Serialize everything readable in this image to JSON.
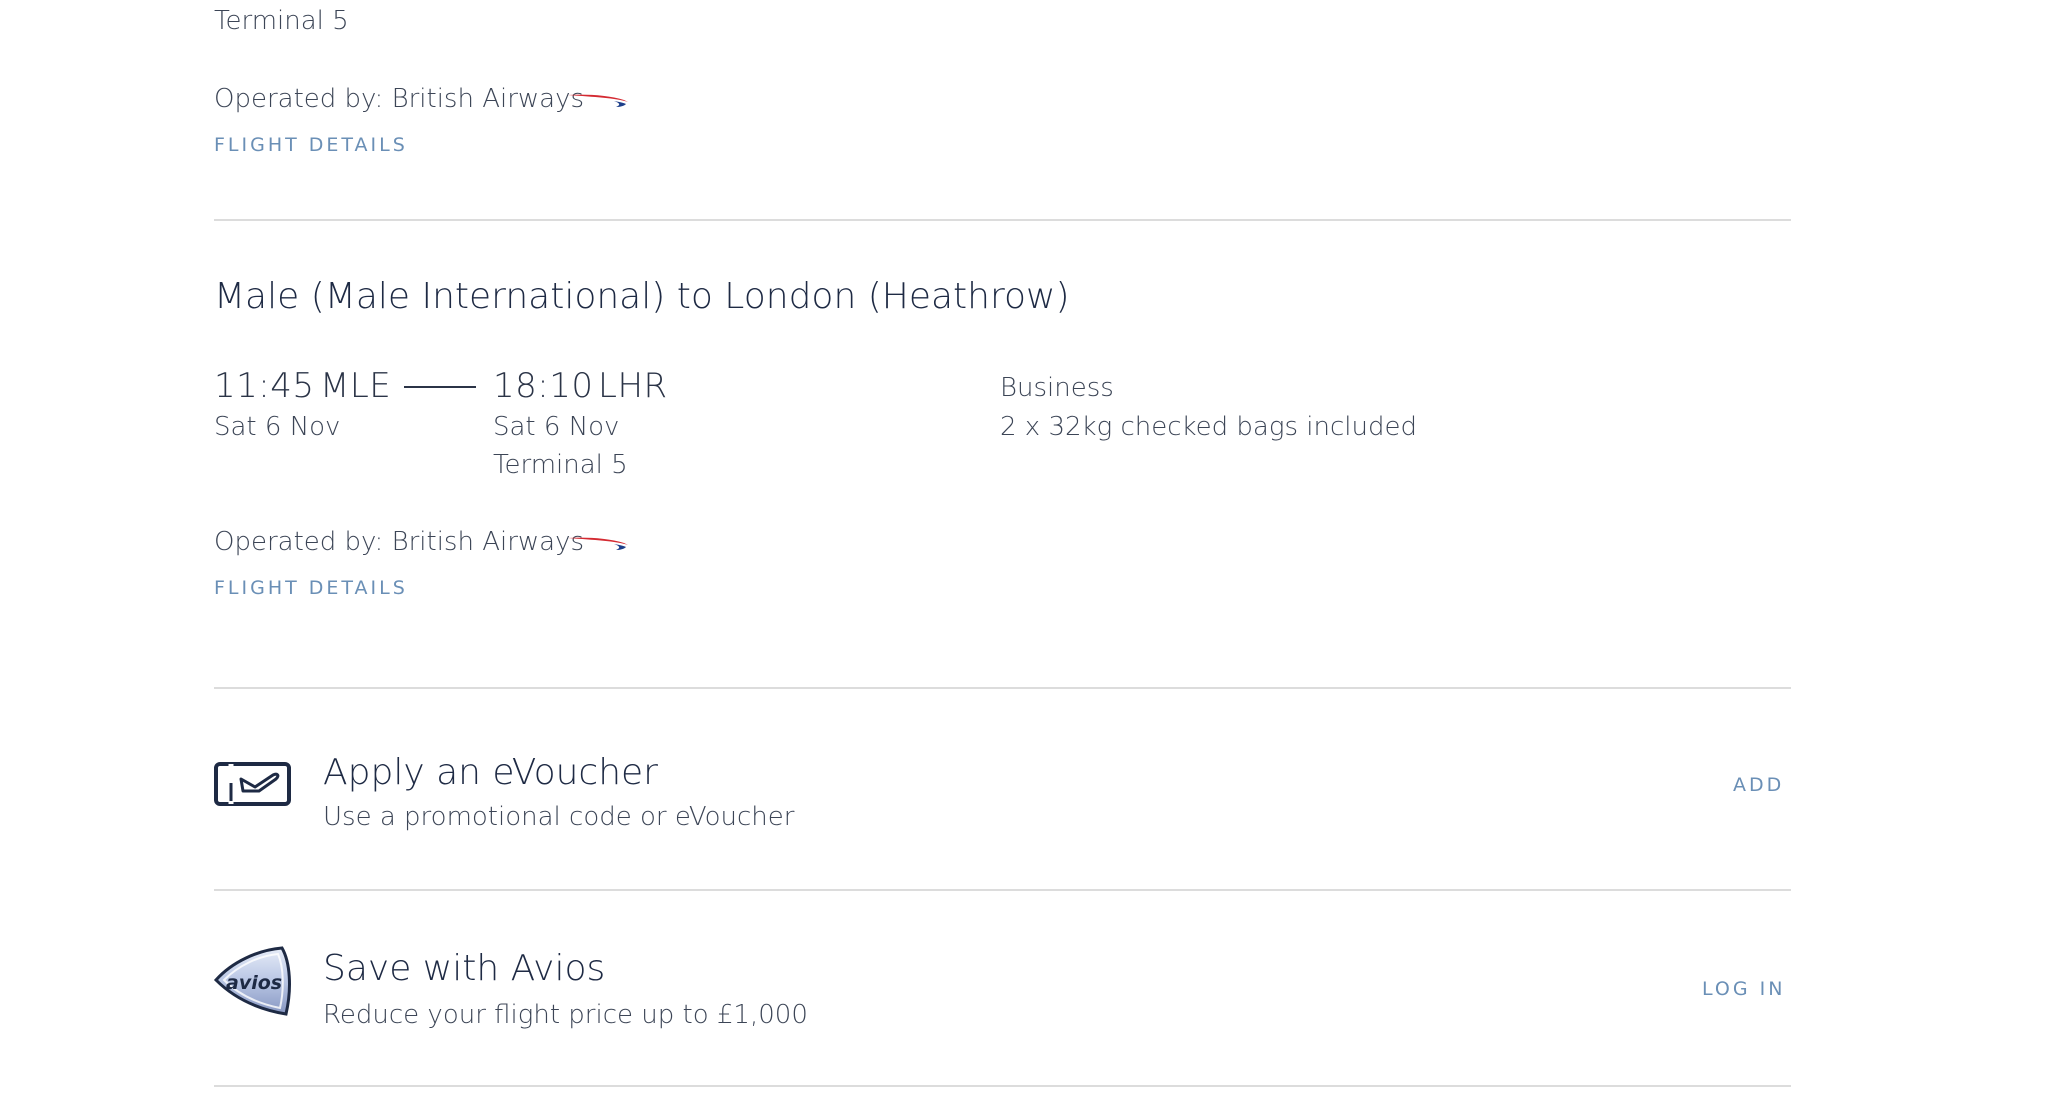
{
  "prev_segment": {
    "arrival_terminal": "Terminal 5",
    "operated_by": "Operated by: British Airways",
    "flight_details": "FLIGHT DETAILS"
  },
  "segment": {
    "title": "Male (Male International) to London (Heathrow)",
    "depart_time": "11:45",
    "depart_code": "MLE",
    "depart_date": "Sat 6 Nov",
    "arrive_time": "18:10",
    "arrive_code": "LHR",
    "arrive_date": "Sat 6 Nov",
    "arrive_terminal": "Terminal 5",
    "cabin": "Business",
    "baggage": "2 x 32kg checked bags included",
    "operated_by": "Operated by: British Airways",
    "flight_details": "FLIGHT DETAILS"
  },
  "evoucher": {
    "title": "Apply an eVoucher",
    "subtitle": "Use a promotional code or eVoucher",
    "action": "ADD"
  },
  "avios": {
    "logo_text": "avios",
    "title": "Save with Avios",
    "subtitle": "Reduce your flight price up to £1,000",
    "action": "LOG IN"
  },
  "colors": {
    "accent_link": "#6a8fb6",
    "ba_red": "#d42a32",
    "ba_blue": "#1d3f8a",
    "divider": "#dcdcdc"
  }
}
